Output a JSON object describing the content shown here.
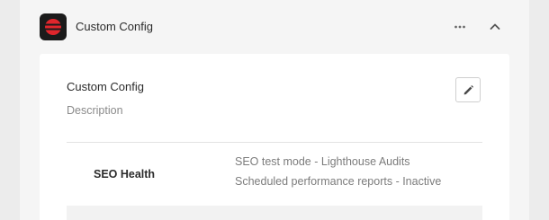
{
  "header": {
    "title": "Custom Config",
    "app_icon": "stacked-bars-logo-icon",
    "more_icon": "more-horizontal-icon",
    "collapse_icon": "chevron-up-icon"
  },
  "config": {
    "title": "Custom Config",
    "description": "Description",
    "edit_icon": "pencil-icon"
  },
  "rows": [
    {
      "label": "SEO Health",
      "details": [
        "SEO test mode - Lighthouse Audits",
        "Scheduled performance reports - Inactive"
      ]
    }
  ],
  "colors": {
    "logo_accent": "#e0262c",
    "page_bg": "#ececec",
    "card_bg": "#ffffff"
  }
}
